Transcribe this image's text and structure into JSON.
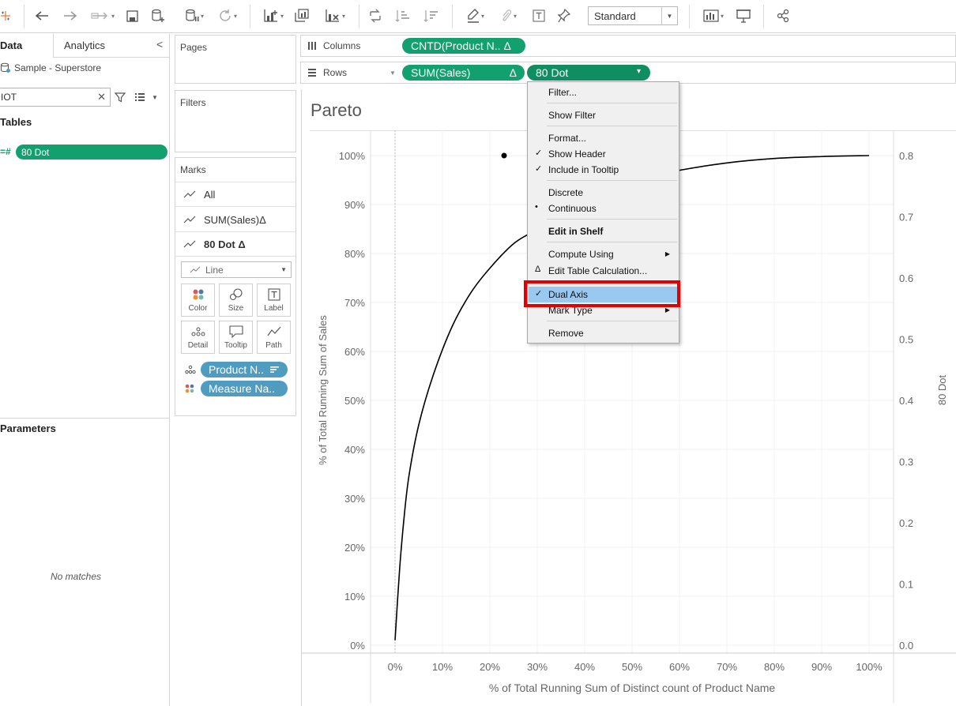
{
  "toolbar": {
    "view_size": "Standard",
    "icons": [
      "tableau-logo-icon",
      "undo-icon",
      "redo-icon",
      "replay-icon",
      "save-icon",
      "new-datasource-icon",
      "pause-updates-icon",
      "refresh-icon",
      "new-worksheet-icon",
      "duplicate-sheet-icon",
      "clear-sheet-icon",
      "swap-icon",
      "sort-ascending-icon",
      "sort-descending-icon",
      "highlight-icon",
      "attach-icon",
      "labels-icon",
      "pin-icon",
      "show-me-icon",
      "presentation-icon",
      "share-icon"
    ]
  },
  "data_pane": {
    "tab_data": "Data",
    "tab_analytics": "Analytics",
    "collapse": "<",
    "datasource": "Sample - Superstore",
    "search_value": "IOT",
    "tables_title": "Tables",
    "field_hash": "=#",
    "field": "80 Dot",
    "parameters_title": "Parameters",
    "no_matches": "No matches"
  },
  "pages_card": {
    "title": "Pages"
  },
  "filters_card": {
    "title": "Filters"
  },
  "marks_card": {
    "title": "Marks",
    "rows": [
      "All",
      "SUM(Sales)",
      "80 Dot"
    ],
    "delta": "Δ",
    "mark_type": "Line",
    "buttons": [
      "Color",
      "Size",
      "Label",
      "Detail",
      "Tooltip",
      "Path"
    ],
    "pills": [
      {
        "label": "Product N..",
        "icon": "detail-icon"
      },
      {
        "label": "Measure Na..",
        "icon": "color-icon"
      }
    ]
  },
  "columns_shelf": {
    "label": "Columns",
    "pill": "CNTD(Product N.. Δ"
  },
  "rows_shelf": {
    "label": "Rows",
    "pill1": "SUM(Sales)",
    "pill1_delta": "Δ",
    "pill2": "80 Dot",
    "pill2_caret": "▾"
  },
  "view": {
    "title": "Pareto"
  },
  "chart_data": {
    "type": "line",
    "title": "Pareto",
    "xlabel": "% of Total Running Sum of Distinct count of Product Name",
    "ylabel": "% of Total Running Sum of Sales",
    "y2label": "80 Dot",
    "xlim": [
      0,
      100
    ],
    "ylim": [
      0,
      100
    ],
    "y2lim": [
      0,
      0.8
    ],
    "x_ticks": [
      "0%",
      "10%",
      "20%",
      "30%",
      "40%",
      "50%",
      "60%",
      "70%",
      "80%",
      "90%",
      "100%"
    ],
    "y_ticks": [
      "0%",
      "10%",
      "20%",
      "30%",
      "40%",
      "50%",
      "60%",
      "70%",
      "80%",
      "90%",
      "100%"
    ],
    "y2_ticks": [
      "0.0",
      "0.1",
      "0.2",
      "0.3",
      "0.4",
      "0.5",
      "0.6",
      "0.7",
      "0.8"
    ],
    "series": [
      {
        "name": "SUM(Sales)",
        "x": [
          0,
          1,
          2,
          3,
          5,
          8,
          12,
          16,
          20,
          25,
          30,
          40,
          50,
          60,
          70,
          80,
          90,
          100
        ],
        "y": [
          1,
          16,
          27,
          35,
          45,
          55,
          65,
          72,
          77,
          82,
          85,
          91,
          95,
          97,
          98.5,
          99.4,
          99.8,
          100
        ]
      },
      {
        "name": "80 Dot",
        "x": [
          23
        ],
        "y": [
          0.8
        ]
      }
    ],
    "grid": true
  },
  "context_menu": {
    "items": [
      {
        "label": "Filter...",
        "check": "",
        "arrow": false,
        "bold": false
      },
      {
        "label": "Show Filter",
        "check": "",
        "arrow": false,
        "bold": false
      },
      {
        "label": "Format...",
        "check": "",
        "arrow": false,
        "bold": false
      },
      {
        "label": "Show Header",
        "check": "✓",
        "arrow": false,
        "bold": false
      },
      {
        "label": "Include in Tooltip",
        "check": "✓",
        "arrow": false,
        "bold": false
      },
      {
        "label": "Discrete",
        "check": "",
        "arrow": false,
        "bold": false
      },
      {
        "label": "Continuous",
        "check": "•",
        "arrow": false,
        "bold": false
      },
      {
        "label": "Edit in Shelf",
        "check": "",
        "arrow": false,
        "bold": true
      },
      {
        "label": "Compute Using",
        "check": "",
        "arrow": true,
        "bold": false
      },
      {
        "label": "Edit Table Calculation...",
        "check": "Δ",
        "arrow": false,
        "bold": false
      },
      {
        "label": "Dual Axis",
        "check": "✓",
        "arrow": false,
        "bold": false
      },
      {
        "label": "Mark Type",
        "check": "",
        "arrow": true,
        "bold": false
      },
      {
        "label": "Remove",
        "check": "",
        "arrow": false,
        "bold": false
      }
    ],
    "arrow_glyph": "▶"
  },
  "colors": {
    "green_pill": "#13a06f",
    "blue_pill": "#4f9cc0",
    "highlight": "#99c9f1",
    "annotation": "#e30000"
  }
}
